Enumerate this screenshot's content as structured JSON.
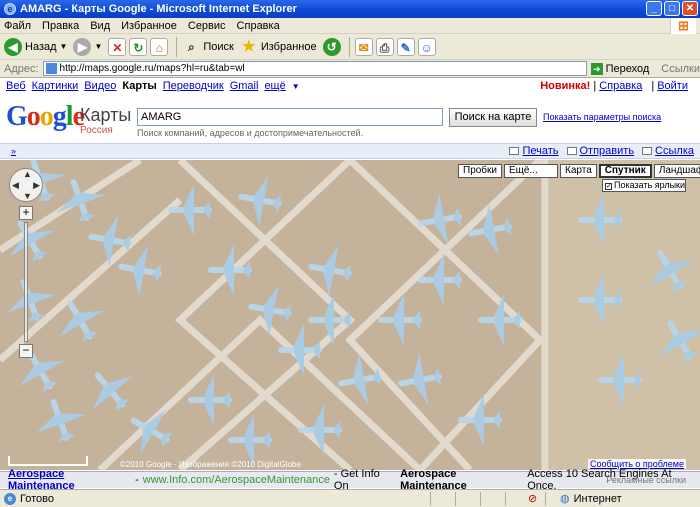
{
  "window": {
    "title": "AMARG - Карты Google - Microsoft Internet Explorer"
  },
  "menu": [
    "Файл",
    "Правка",
    "Вид",
    "Избранное",
    "Сервис",
    "Справка"
  ],
  "toolbar": {
    "back": "Назад",
    "search": "Поиск",
    "favorites": "Избранное"
  },
  "address": {
    "label": "Адрес:",
    "url": "http://maps.google.ru/maps?hl=ru&tab=wl",
    "go": "Переход",
    "links": "Ссылки"
  },
  "gnav": {
    "items": [
      "Веб",
      "Картинки",
      "Видео"
    ],
    "active": "Карты",
    "items2": [
      "Переводчик",
      "Gmail",
      "ещё"
    ],
    "more_arrow": "▼",
    "new": "Новинка!",
    "help": "Справка",
    "signin": "Войти"
  },
  "header": {
    "maps_label": "Карты",
    "region": "Россия",
    "search_value": "AMARG",
    "search_hint": "Поиск компаний, адресов и достопримечательностей.",
    "search_button": "Поиск на карте",
    "options": "Показать параметры поиска"
  },
  "strip": {
    "collapse": "»",
    "print": "Печать",
    "send": "Отправить",
    "link": "Ссылка"
  },
  "map": {
    "traffic": "Пробки",
    "more": "Ещё...",
    "map": "Карта",
    "satellite": "Спутник",
    "terrain": "Ландшафт",
    "labels": "Показать ярлыки",
    "report": "Сообщить о проблеме",
    "credit": "©2010 Google - Изображения ©2010 DigitalGlobe"
  },
  "ad": {
    "title": "Aerospace Maintenance",
    "url": "www.Info.com/AerospaceMaintenance",
    "text_pre": "- Get Info On",
    "text_bold": "Aerospace Maintenance",
    "text_post": "Access 10 Search Engines At Once.",
    "label": "Рекламные ссылки"
  },
  "status": {
    "text": "Готово",
    "zone": "Интернет"
  },
  "colors": {
    "accent": "#0a49d4",
    "link": "#0000cc"
  }
}
